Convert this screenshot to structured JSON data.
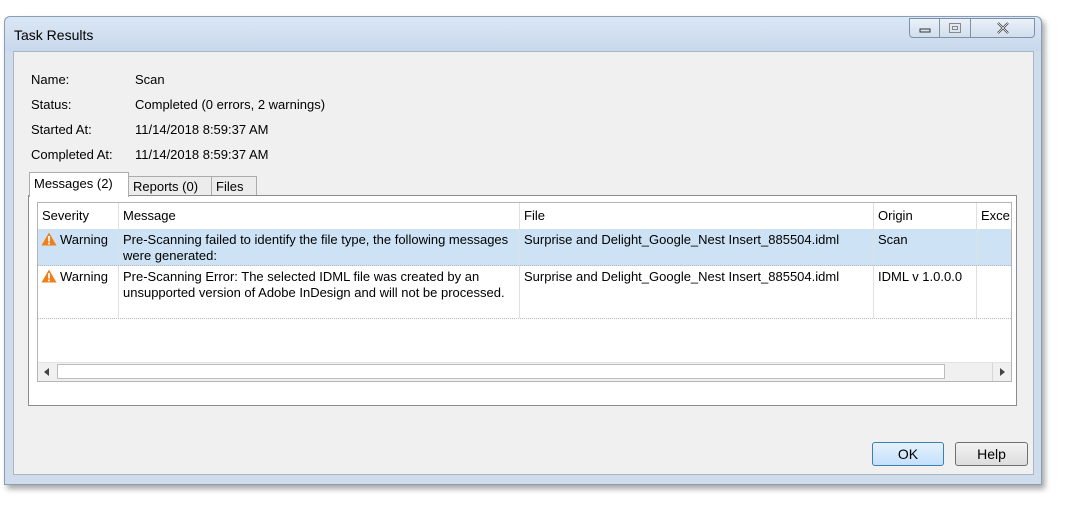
{
  "window": {
    "title": "Task Results"
  },
  "info": [
    {
      "label": "Name:",
      "value": "Scan"
    },
    {
      "label": "Status:",
      "value": "Completed (0 errors, 2 warnings)"
    },
    {
      "label": "Started At:",
      "value": "11/14/2018 8:59:37 AM"
    },
    {
      "label": "Completed At:",
      "value": "11/14/2018 8:59:37 AM"
    }
  ],
  "tabs": [
    {
      "label": "Messages (2)",
      "active": true
    },
    {
      "label": "Reports (0)",
      "active": false
    },
    {
      "label": "Files",
      "active": false
    }
  ],
  "grid": {
    "columns": [
      "Severity",
      "Message",
      "File",
      "Origin",
      "Exce"
    ],
    "rows": [
      {
        "severity": "Warning",
        "message": "Pre-Scanning failed to identify the file type, the following messages were generated:",
        "file": "Surprise and Delight_Google_Nest Insert_885504.idml",
        "origin": "Scan",
        "selected": true
      },
      {
        "severity": "Warning",
        "message": "Pre-Scanning Error: The selected IDML file was created by an unsupported version of Adobe InDesign and will not be processed.",
        "file": "Surprise and Delight_Google_Nest Insert_885504.idml",
        "origin": "IDML v 1.0.0.0",
        "selected": false
      }
    ]
  },
  "buttons": {
    "ok": "OK",
    "help": "Help"
  },
  "icons": {
    "severity": "warning-triangle-icon",
    "scroll_left": "chevron-left-icon",
    "scroll_right": "chevron-right-icon"
  },
  "colors": {
    "warning": "#f07f1a",
    "selected_row": "#cde3f5"
  }
}
